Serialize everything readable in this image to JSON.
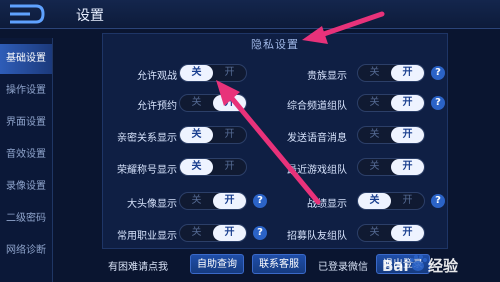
{
  "header": {
    "title": "设置"
  },
  "sidebar": {
    "items": [
      {
        "label": "基础设置",
        "active": true
      },
      {
        "label": "操作设置",
        "active": false
      },
      {
        "label": "界面设置",
        "active": false
      },
      {
        "label": "音效设置",
        "active": false
      },
      {
        "label": "录像设置",
        "active": false
      },
      {
        "label": "二级密码",
        "active": false
      },
      {
        "label": "网络诊断",
        "active": false
      }
    ]
  },
  "panel": {
    "title": "隐私设置",
    "left": [
      {
        "label": "允许观战",
        "off": "关",
        "on": "开",
        "value": "off",
        "help": false
      },
      {
        "label": "允许预约",
        "off": "关",
        "on": "开",
        "value": "on",
        "help": false
      },
      {
        "label": "亲密关系显示",
        "off": "关",
        "on": "开",
        "value": "off",
        "help": false
      },
      {
        "label": "荣耀称号显示",
        "off": "关",
        "on": "开",
        "value": "off",
        "help": false
      },
      {
        "label": "大头像显示",
        "off": "关",
        "on": "开",
        "value": "on",
        "help": true
      },
      {
        "label": "常用职业显示",
        "off": "关",
        "on": "开",
        "value": "on",
        "help": true
      }
    ],
    "right": [
      {
        "label": "贵族显示",
        "off": "关",
        "on": "开",
        "value": "on",
        "help": true
      },
      {
        "label": "综合频道组队",
        "off": "关",
        "on": "开",
        "value": "on",
        "help": true
      },
      {
        "label": "发送语音消息",
        "off": "关",
        "on": "开",
        "value": "on",
        "help": false
      },
      {
        "label": "最近游戏组队",
        "off": "关",
        "on": "开",
        "value": "on",
        "help": false
      },
      {
        "label": "战绩显示",
        "off": "关",
        "on": "开",
        "value": "off",
        "help": true
      },
      {
        "label": "招募队友组队",
        "off": "关",
        "on": "开",
        "value": "on",
        "help": false
      }
    ]
  },
  "footer": {
    "help_text": "有困难请点我",
    "query_button": "自助查询",
    "service_button": "联系客服",
    "login_text": "已登录微信",
    "logout_button": "退出登录"
  },
  "watermark": "Bai 经验",
  "colors": {
    "accent": "#2b63c7",
    "arrow": "#e8327a"
  }
}
